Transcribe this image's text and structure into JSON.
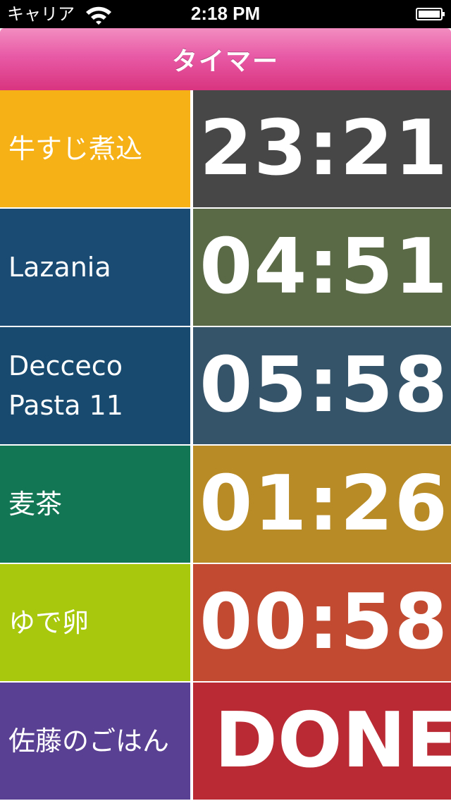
{
  "status_bar": {
    "carrier": "キャリア",
    "time": "2:18 PM"
  },
  "nav": {
    "title": "タイマー",
    "color": "#e34a9b"
  },
  "timers": [
    {
      "name": "牛すじ煮込",
      "time": "23:21",
      "name_color": "#f6b116",
      "time_color": "#474747"
    },
    {
      "name": "Lazania",
      "time": "04:51",
      "name_color": "#1a4b73",
      "time_color": "#5a6a46"
    },
    {
      "name": "Decceco Pasta 11",
      "time": "05:58",
      "name_color": "#174a6e",
      "time_color": "#355369"
    },
    {
      "name": "麦茶",
      "time": "01:26",
      "name_color": "#127553",
      "time_color": "#b98b26"
    },
    {
      "name": "ゆで卵",
      "time": "00:58",
      "name_color": "#a8c80e",
      "time_color": "#c14a30"
    },
    {
      "name": "佐藤のごはん",
      "time": "DONE",
      "name_color": "#5a4092",
      "time_color": "#ba2a34"
    }
  ]
}
